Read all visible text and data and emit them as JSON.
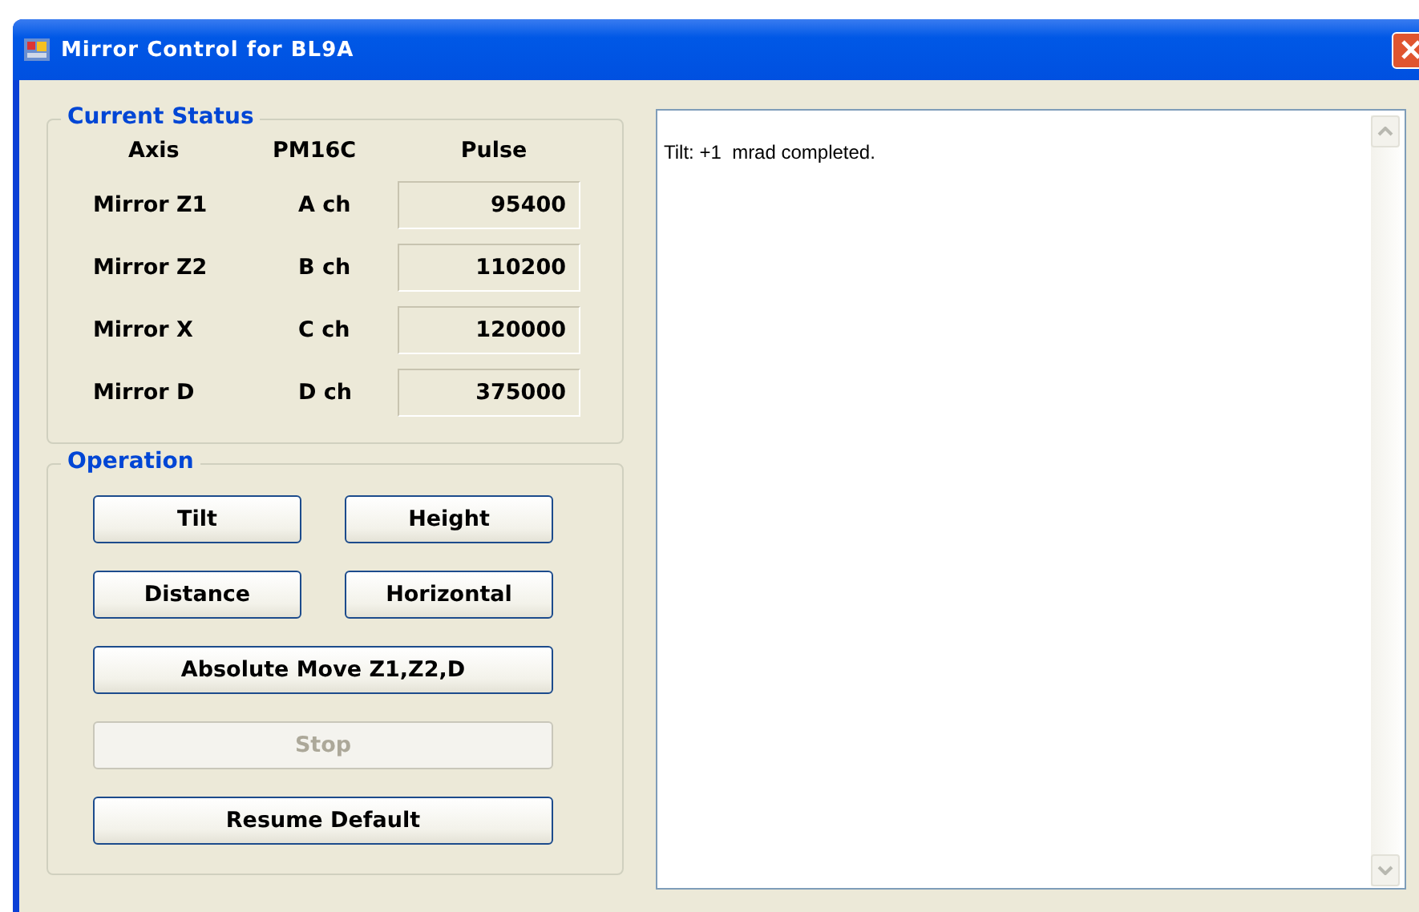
{
  "window": {
    "title": "Mirror Control for BL9A"
  },
  "current_status": {
    "title": "Current Status",
    "columns": [
      "Axis",
      "PM16C",
      "Pulse"
    ],
    "rows": [
      {
        "axis": "Mirror Z1",
        "channel": "A ch",
        "pulse": "95400"
      },
      {
        "axis": "Mirror Z2",
        "channel": "B ch",
        "pulse": "110200"
      },
      {
        "axis": "Mirror X",
        "channel": "C ch",
        "pulse": "120000"
      },
      {
        "axis": "Mirror D",
        "channel": "D ch",
        "pulse": "375000"
      }
    ]
  },
  "operation": {
    "title": "Operation",
    "buttons": [
      {
        "label": "Tilt",
        "kind": "half",
        "disabled": false
      },
      {
        "label": "Height",
        "kind": "half",
        "disabled": false
      },
      {
        "label": "Distance",
        "kind": "half",
        "disabled": false
      },
      {
        "label": "Horizontal",
        "kind": "half",
        "disabled": false
      },
      {
        "label": "Absolute Move Z1,Z2,D",
        "kind": "full",
        "disabled": false
      },
      {
        "label": "Stop",
        "kind": "full",
        "disabled": true
      },
      {
        "label": "Resume Default",
        "kind": "full",
        "disabled": false
      }
    ]
  },
  "log": {
    "lines": [
      "Tilt: +1  mrad completed."
    ]
  }
}
